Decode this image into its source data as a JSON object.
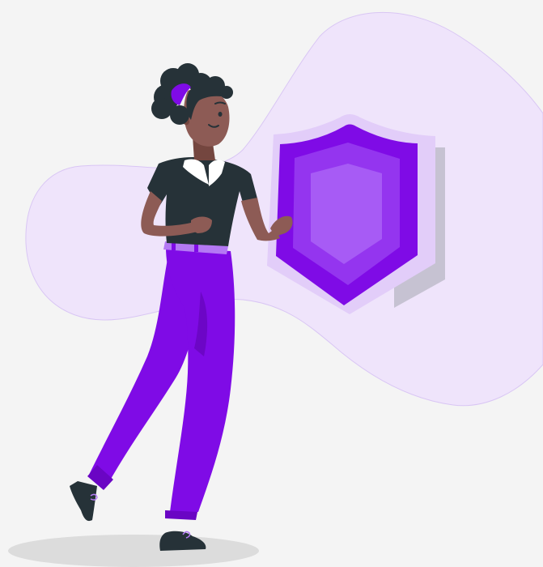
{
  "illustration": {
    "subject": "person-holding-shield",
    "colors": {
      "background": "#f4f4f4",
      "blob": "#efe4fb",
      "blob_stroke": "#d9c6f4",
      "shadow": "#dcdcdc",
      "shield_outer": "#e2cdf9",
      "shield_back": "#c6c2d2",
      "shield_main": "#7f0be6",
      "shield_mid": "#9435ef",
      "shield_inner": "#a75bf5",
      "pants": "#7f0be6",
      "pants_shade": "#6c06c6",
      "pants_cuff": "#6a05c4",
      "belt": "#b479f4",
      "shirt": "#263238",
      "collar": "#ffffff",
      "skin": "#8d5b55",
      "skin_shade": "#74463f",
      "hair": "#263238",
      "hair_band": "#7f0be6",
      "shoe": "#263238",
      "lace": "#b479f4"
    }
  }
}
